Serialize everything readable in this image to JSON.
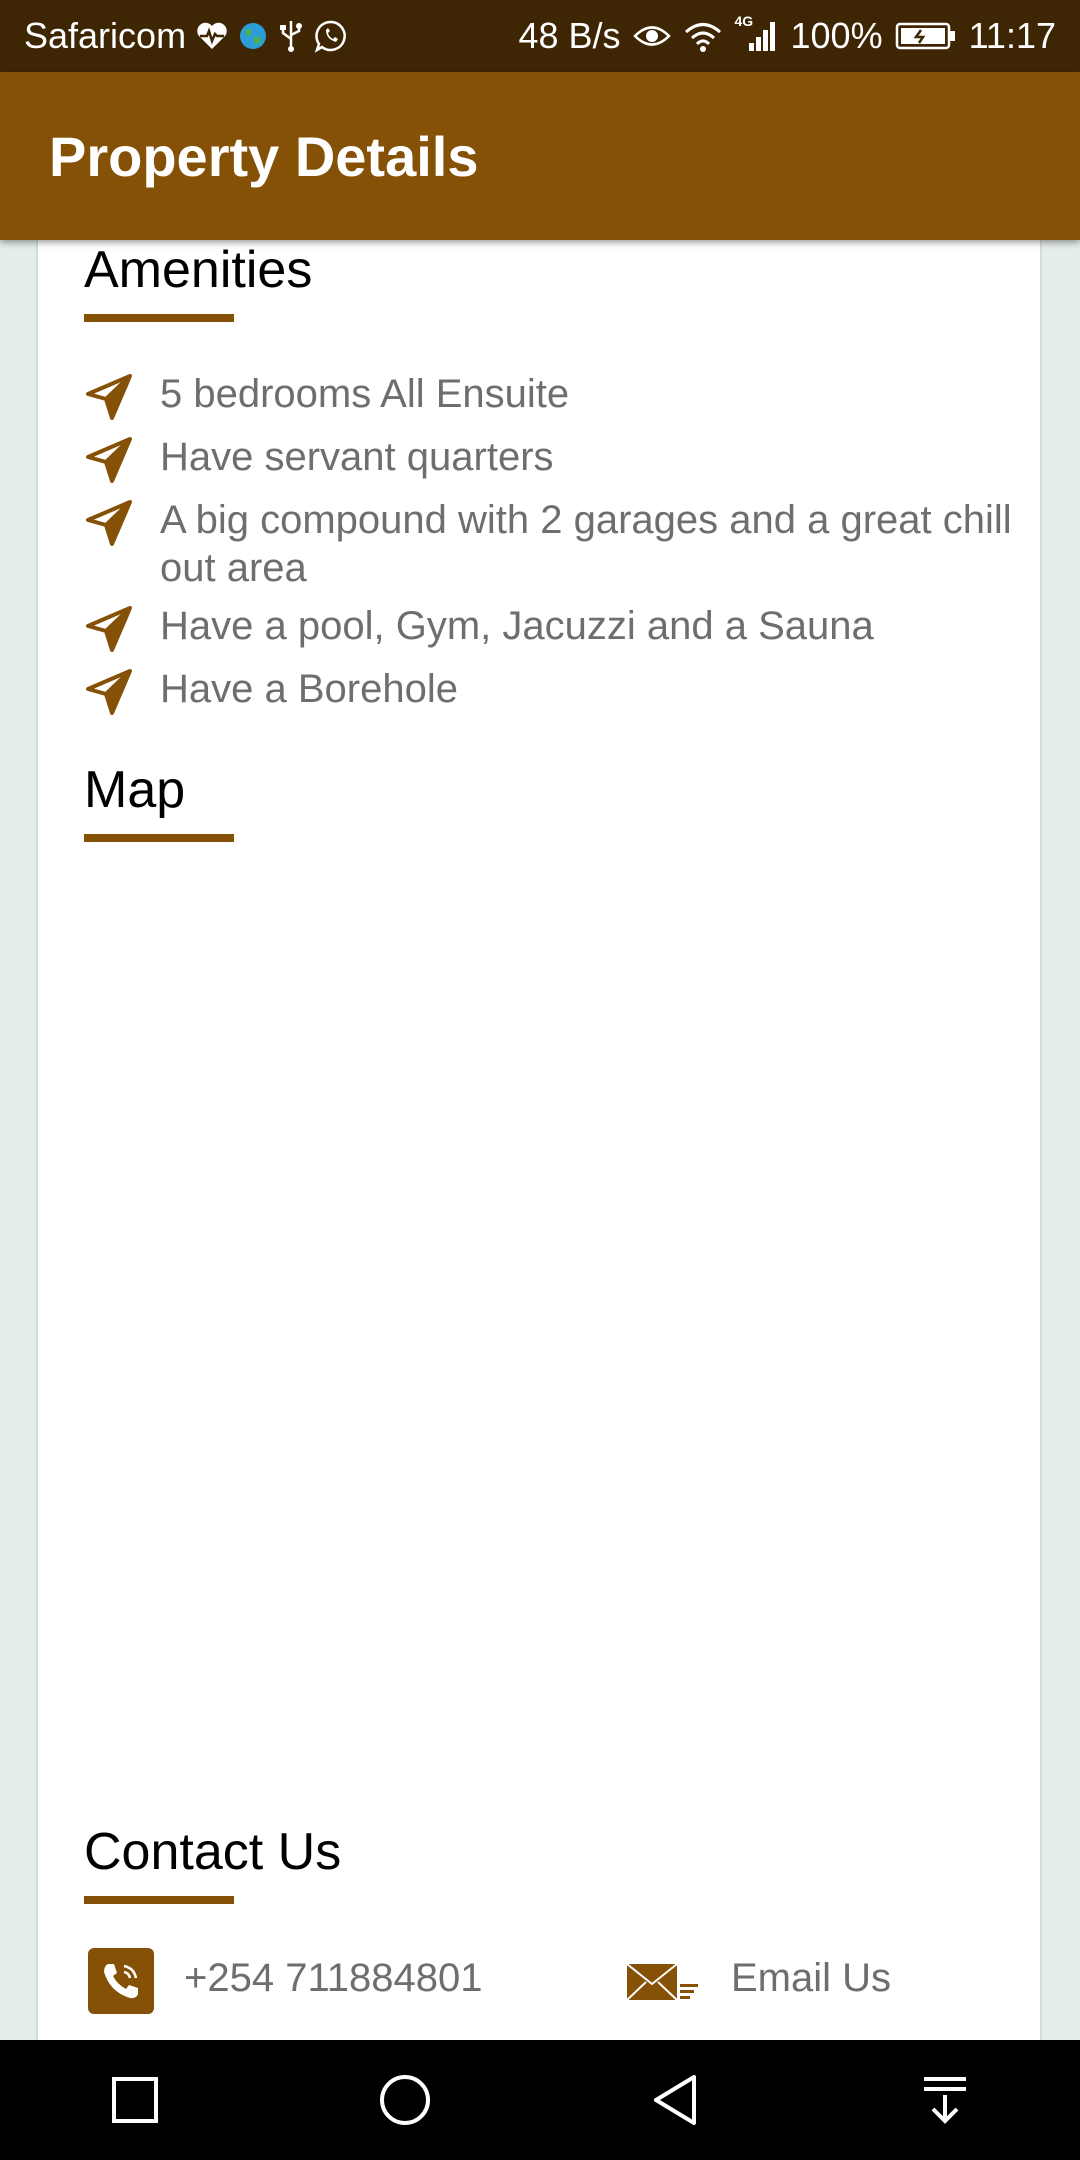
{
  "status_bar": {
    "carrier": "Safaricom",
    "net_speed": "48 B/s",
    "network_type": "4G",
    "battery": "100%",
    "time": "11:17"
  },
  "app_bar": {
    "title": "Property Details"
  },
  "amenities": {
    "title": "Amenities",
    "items": [
      {
        "label": "5 bedrooms All Ensuite"
      },
      {
        "label": "Have servant quarters"
      },
      {
        "label": "A big compound with 2 garages and a great chill out area"
      },
      {
        "label": "Have a pool, Gym, Jacuzzi and a Sauna"
      },
      {
        "label": "Have a Borehole"
      }
    ],
    "icon": "navigation-arrow-icon"
  },
  "map": {
    "title": "Map"
  },
  "contact": {
    "title": "Contact Us",
    "phone": "+254 711884801",
    "email_label": "Email Us"
  },
  "colors": {
    "accent": "#845106",
    "status_bar": "#3e2604",
    "text_secondary": "#6e6e6e"
  }
}
